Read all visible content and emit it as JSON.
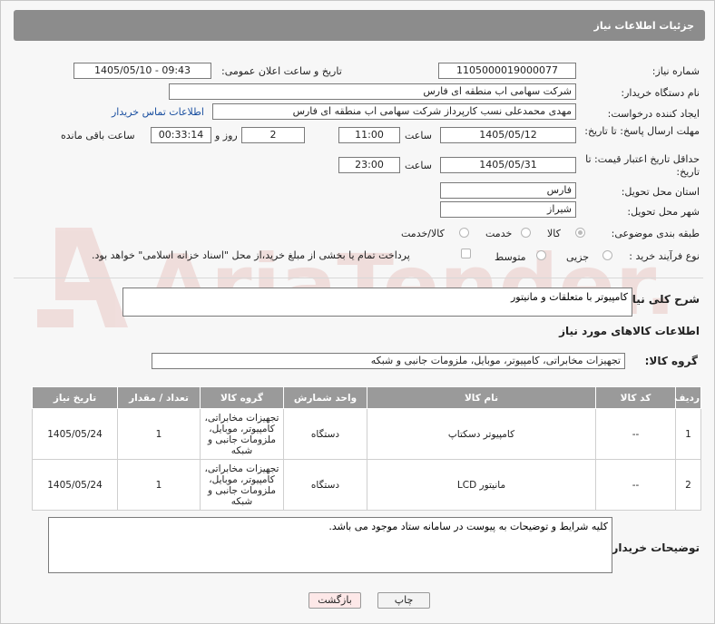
{
  "header": {
    "title": "جزئیات اطلاعات نیاز"
  },
  "fields": {
    "need_number_label": "شماره نیاز:",
    "need_number": "1105000019000077",
    "announce_label": "تاریخ و ساعت اعلان عمومی:",
    "announce_value": "1405/05/10 - 09:43",
    "buyer_org_label": "نام دستگاه خریدار:",
    "buyer_org": "شرکت سهامی اب منطقه ای فارس",
    "requester_label": "ایجاد کننده درخواست:",
    "requester": "مهدی محمدعلی نسب کارپرداز شرکت سهامی اب منطقه ای فارس",
    "contact_link": "اطلاعات تماس خریدار",
    "deadline_label": "مهلت ارسال پاسخ: تا تاریخ:",
    "deadline_date": "1405/05/12",
    "time_label": "ساعت",
    "deadline_time": "11:00",
    "days_value": "2",
    "days_and_label": "روز و",
    "remaining_time": "00:33:14",
    "remaining_label": "ساعت باقی مانده",
    "validity_label": "حداقل تاریخ اعتبار قیمت: تا تاریخ:",
    "validity_date": "1405/05/31",
    "validity_time": "23:00",
    "province_label": "استان محل تحویل:",
    "province": "فارس",
    "city_label": "شهر محل تحویل:",
    "city": "شیراز",
    "category_label": "طبقه بندی موضوعی:",
    "category_options": [
      "کالا",
      "خدمت",
      "کالا/خدمت"
    ],
    "purchase_type_label": "نوع فرآیند خرید :",
    "purchase_options": [
      "جزیی",
      "متوسط"
    ],
    "payment_note": "پرداخت تمام یا بخشی از مبلغ خرید،از محل \"اسناد خزانه اسلامی\" خواهد بود.",
    "general_desc_label": "شرح کلی نیاز:",
    "general_desc": "کامپیوتر با متعلقات و مانیتور",
    "goods_info_title": "اطلاعات کالاهای مورد نیاز",
    "goods_group_label": "گروه کالا:",
    "goods_group": "تجهیزات مخابراتی، کامپیوتر، موبایل، ملزومات جانبی و شبکه",
    "buyer_notes_label": "توضیحات خریدار:",
    "buyer_notes": "کلیه شرایط و توضیحات به پیوست در سامانه ستاد موجود می باشد."
  },
  "table": {
    "headers": [
      "ردیف",
      "کد کالا",
      "نام کالا",
      "واحد شمارش",
      "گروه کالا",
      "تعداد / مقدار",
      "تاریخ نیاز"
    ],
    "rows": [
      [
        "1",
        "--",
        "کامپیوتر دسکتاپ",
        "دستگاه",
        "تجهیزات مخابراتی، کامپیوتر، موبایل، ملزومات جانبی و شبکه",
        "1",
        "1405/05/24"
      ],
      [
        "2",
        "--",
        "مانیتور LCD",
        "دستگاه",
        "تجهیزات مخابراتی، کامپیوتر، موبایل، ملزومات جانبی و شبکه",
        "1",
        "1405/05/24"
      ]
    ]
  },
  "buttons": {
    "print": "چاپ",
    "back": "بازگشت"
  },
  "watermark": {
    "text": "AriaTender.net"
  },
  "colors": {
    "header_bg": "#8c8c8c",
    "back_button_bg": "#fde8e8",
    "link": "#1a4fa0"
  }
}
